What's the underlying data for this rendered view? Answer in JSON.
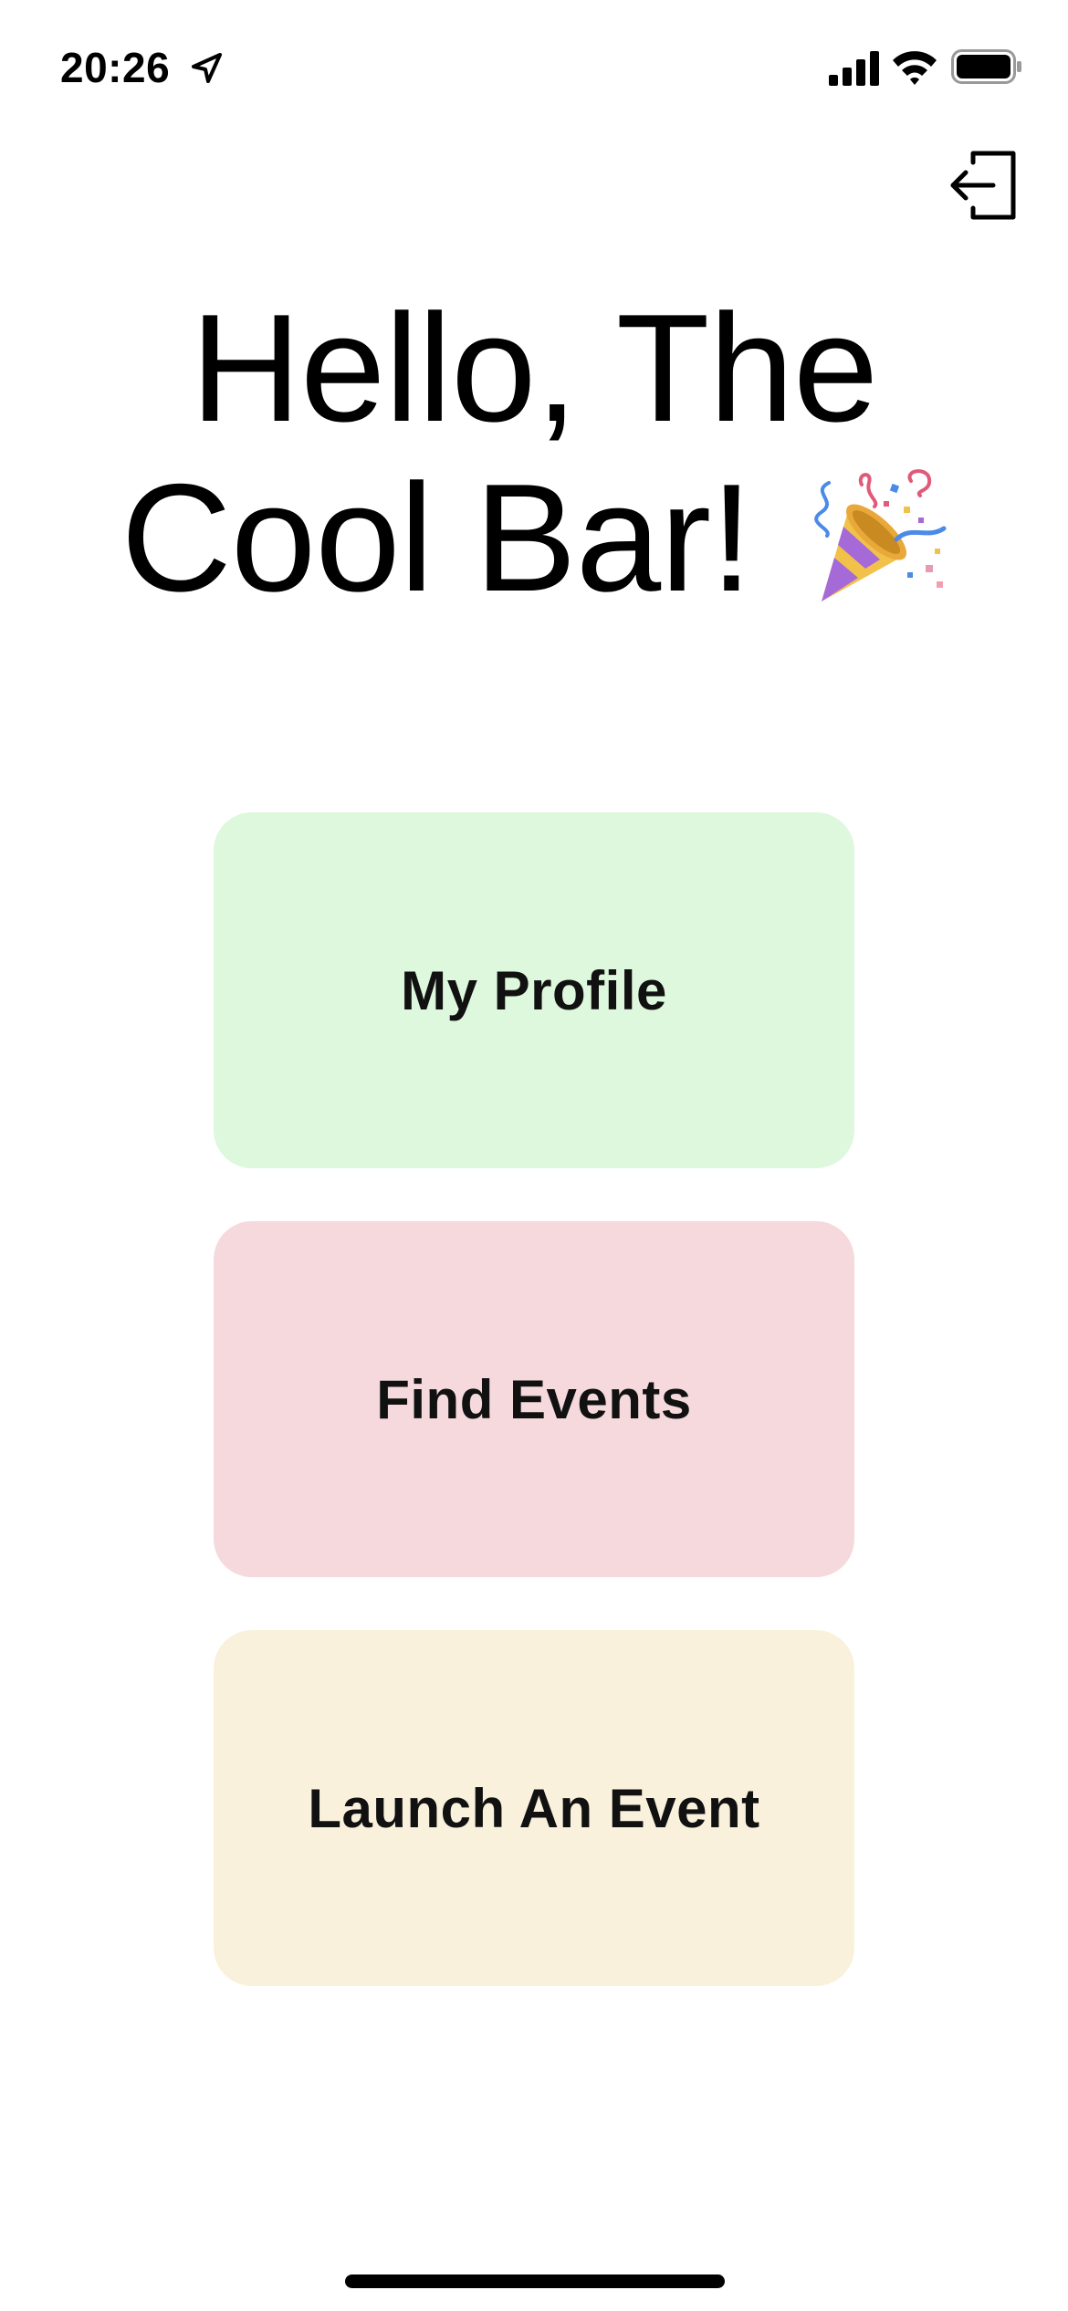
{
  "status_bar": {
    "time": "20:26",
    "icons": [
      "location-arrow-icon",
      "cellular-signal-icon",
      "wifi-icon",
      "battery-icon"
    ]
  },
  "header": {
    "logout_icon": "logout-icon"
  },
  "greeting": {
    "text": "Hello, The Cool Bar!",
    "emoji_icon": "party-popper-icon"
  },
  "menu": {
    "items": [
      {
        "label": "My Profile",
        "color": "#ddf8dc"
      },
      {
        "label": "Find Events",
        "color": "#f5d9dc"
      },
      {
        "label": "Launch An Event",
        "color": "#f9f1dc"
      }
    ]
  }
}
